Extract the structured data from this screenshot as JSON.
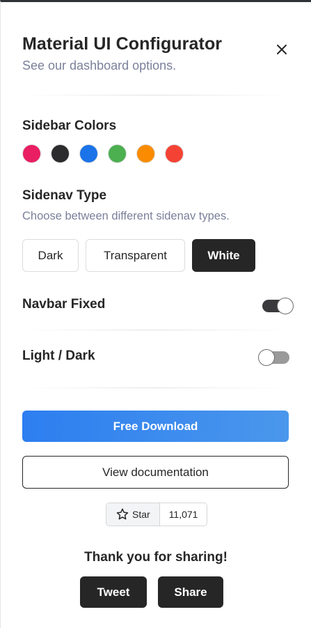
{
  "header": {
    "title": "Material UI Configurator",
    "subtitle": "See our dashboard options.",
    "close_icon": "close-icon"
  },
  "sidebar_colors": {
    "label": "Sidebar Colors",
    "swatches": [
      {
        "name": "pink",
        "color": "#e91e63"
      },
      {
        "name": "dark",
        "color": "#2c2c2e"
      },
      {
        "name": "blue",
        "color": "#1a73e8"
      },
      {
        "name": "green",
        "color": "#4caf50"
      },
      {
        "name": "orange",
        "color": "#fb8c00"
      },
      {
        "name": "red",
        "color": "#f44335"
      }
    ]
  },
  "sidenav_type": {
    "label": "Sidenav Type",
    "description": "Choose between different sidenav types.",
    "options": [
      "Dark",
      "Transparent",
      "White"
    ],
    "selected": "White"
  },
  "navbar_fixed": {
    "label": "Navbar Fixed",
    "on": true
  },
  "light_dark": {
    "label": "Light / Dark",
    "on": false
  },
  "actions": {
    "download_label": "Free Download",
    "docs_label": "View documentation"
  },
  "github": {
    "star_label": "Star",
    "star_icon": "star-icon",
    "count": "11,071"
  },
  "share": {
    "thanks": "Thank you for sharing!",
    "tweet_label": "Tweet",
    "share_label": "Share"
  },
  "colors": {
    "accent_blue": "#2d7ef0",
    "dark": "#262626",
    "muted_text": "#7b809a"
  }
}
